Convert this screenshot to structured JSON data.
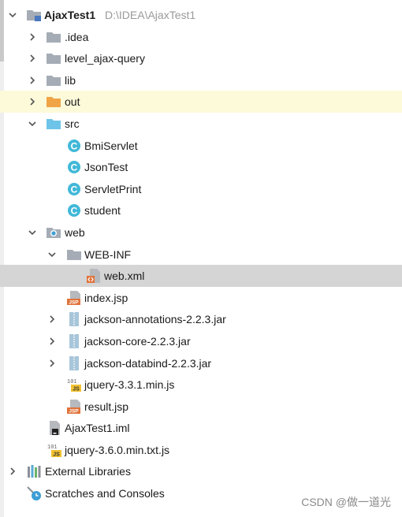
{
  "project": {
    "name": "AjaxTest1",
    "path": "D:\\IDEA\\AjaxTest1"
  },
  "tree": [
    {
      "label": "AjaxTest1",
      "icon": "module-folder-icon",
      "expanded": true
    },
    {
      "label": ".idea",
      "icon": "folder-icon",
      "expanded": false
    },
    {
      "label": "level_ajax-query",
      "icon": "folder-icon",
      "expanded": false
    },
    {
      "label": "lib",
      "icon": "folder-icon",
      "expanded": false
    },
    {
      "label": "out",
      "icon": "excluded-folder-icon",
      "expanded": false,
      "highlighted": true
    },
    {
      "label": "src",
      "icon": "source-folder-icon",
      "expanded": true
    },
    {
      "label": "BmiServlet",
      "icon": "java-class-icon"
    },
    {
      "label": "JsonTest",
      "icon": "java-class-icon"
    },
    {
      "label": "ServletPrint",
      "icon": "java-class-icon"
    },
    {
      "label": "student",
      "icon": "java-class-icon"
    },
    {
      "label": "web",
      "icon": "web-folder-icon",
      "expanded": true
    },
    {
      "label": "WEB-INF",
      "icon": "folder-icon",
      "expanded": true
    },
    {
      "label": "web.xml",
      "icon": "xml-file-icon",
      "selected": true
    },
    {
      "label": "index.jsp",
      "icon": "jsp-file-icon"
    },
    {
      "label": "jackson-annotations-2.2.3.jar",
      "icon": "jar-file-icon",
      "expanded": false
    },
    {
      "label": "jackson-core-2.2.3.jar",
      "icon": "jar-file-icon",
      "expanded": false
    },
    {
      "label": "jackson-databind-2.2.3.jar",
      "icon": "jar-file-icon",
      "expanded": false
    },
    {
      "label": "jquery-3.3.1.min.js",
      "icon": "js-file-icon"
    },
    {
      "label": "result.jsp",
      "icon": "jsp-file-icon"
    },
    {
      "label": "AjaxTest1.iml",
      "icon": "iml-file-icon"
    },
    {
      "label": "jquery-3.6.0.min.txt.js",
      "icon": "js-file-icon"
    },
    {
      "label": "External Libraries",
      "icon": "libraries-icon",
      "expanded": false
    },
    {
      "label": "Scratches and Consoles",
      "icon": "scratches-icon"
    }
  ],
  "watermark": "CSDN @做一道光",
  "colors": {
    "folder": "#a5acb5",
    "excluded_folder": "#f0a446",
    "source_folder": "#6ec4e8",
    "class_icon": "#41b8d8",
    "highlight_row": "#fcfad9",
    "selected_row": "#d5d5d5"
  }
}
